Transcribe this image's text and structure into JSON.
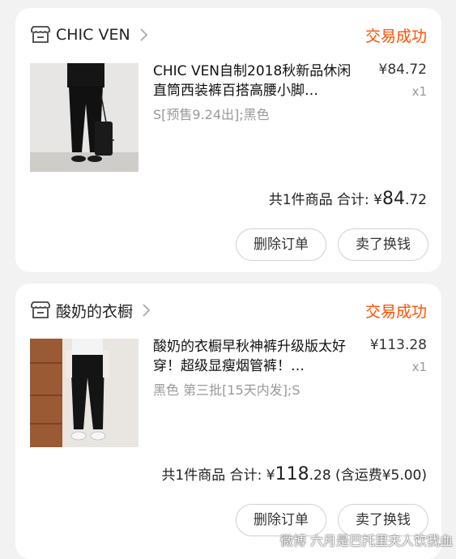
{
  "orders": [
    {
      "shop_name": "CHIC VEN",
      "status": "交易成功",
      "item_title": "CHIC VEN自制2018秋新品休闲直筒西装裤百搭高腰小脚…",
      "item_sku": "S[预售9.24出];黑色",
      "item_price": "¥84.72",
      "item_qty": "x1",
      "summary_prefix": "共1件商品 合计: ¥",
      "total_int": "84",
      "total_dec": ".72",
      "summary_suffix": "",
      "btn_delete": "删除订单",
      "btn_sell": "卖了换钱"
    },
    {
      "shop_name": "酸奶的衣橱",
      "status": "交易成功",
      "item_title": "酸奶的衣橱早秋神裤升级版太好穿！超级显瘦烟管裤！…",
      "item_sku": "黑色 第三批[15天内发];S",
      "item_price": "¥113.28",
      "item_qty": "x1",
      "summary_prefix": "共1件商品 合计: ¥",
      "total_int": "118",
      "total_dec": ".28",
      "summary_suffix": " (含运费¥5.00)",
      "btn_delete": "删除订单",
      "btn_sell": "卖了换钱"
    }
  ],
  "watermark": "微博 六月是巴托里夫人饮我血",
  "colors": {
    "accent": "#ff5000",
    "background": "#f2f2f2"
  }
}
